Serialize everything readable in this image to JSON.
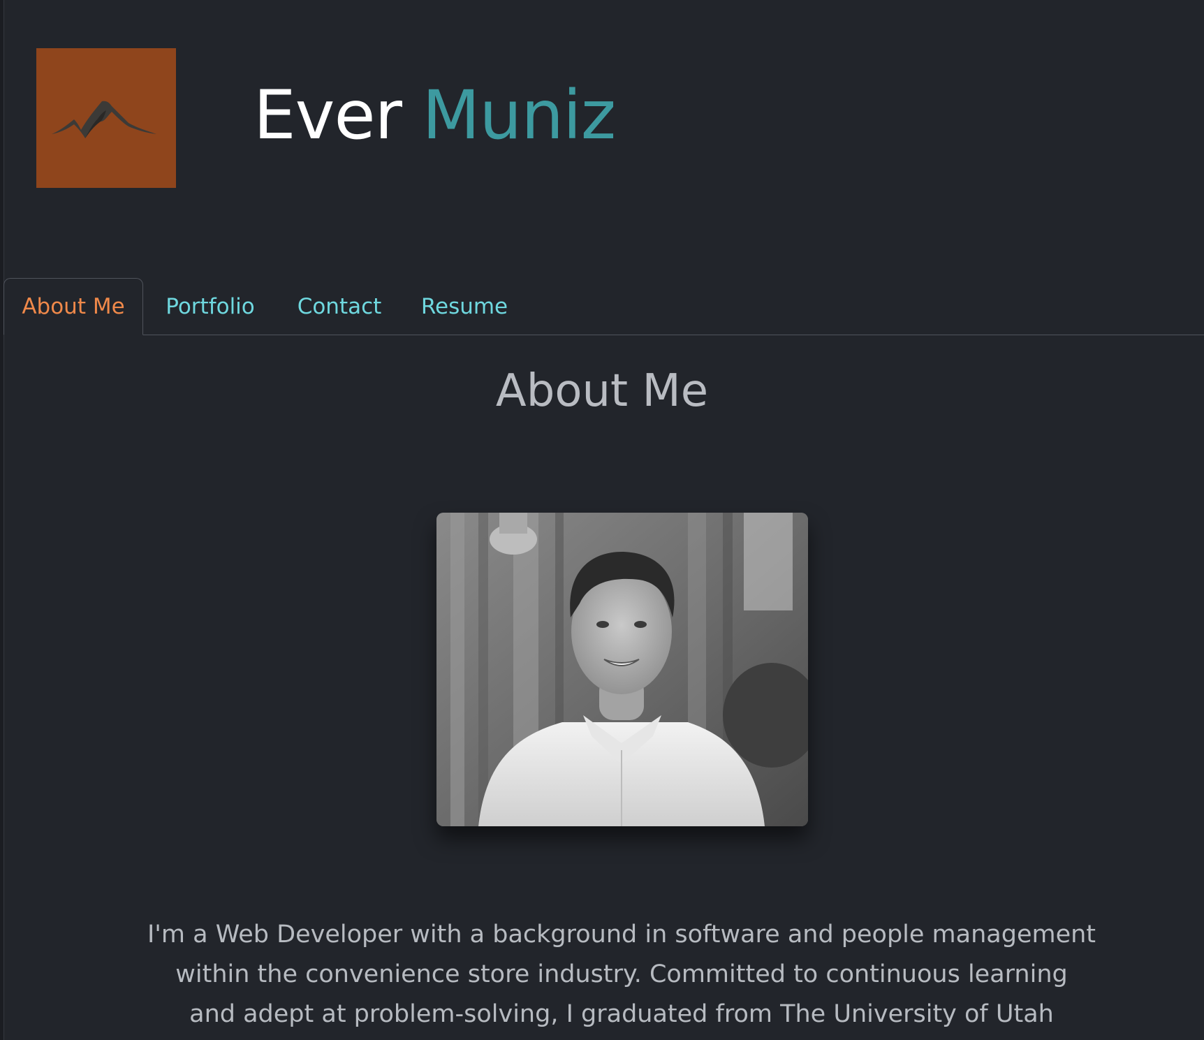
{
  "header": {
    "logo_icon": "mountain-icon",
    "name_first": "Ever",
    "name_last": "Muniz"
  },
  "colors": {
    "background": "#22252b",
    "logo_bg": "#8f451c",
    "accent_teal": "#3d9aa0",
    "tab_link": "#6fd8df",
    "tab_active": "#f0894a"
  },
  "nav": {
    "tabs": [
      {
        "label": "About Me",
        "active": true
      },
      {
        "label": "Portfolio",
        "active": false
      },
      {
        "label": "Contact",
        "active": false
      },
      {
        "label": "Resume",
        "active": false
      }
    ]
  },
  "about": {
    "heading": "About Me",
    "photo_icon": "profile-photo",
    "bio_lines": [
      "I'm a Web Developer with a background in software and people management",
      "within the convenience store industry. Committed to continuous learning",
      "and adept at problem-solving, I graduated from The University of Utah"
    ]
  }
}
